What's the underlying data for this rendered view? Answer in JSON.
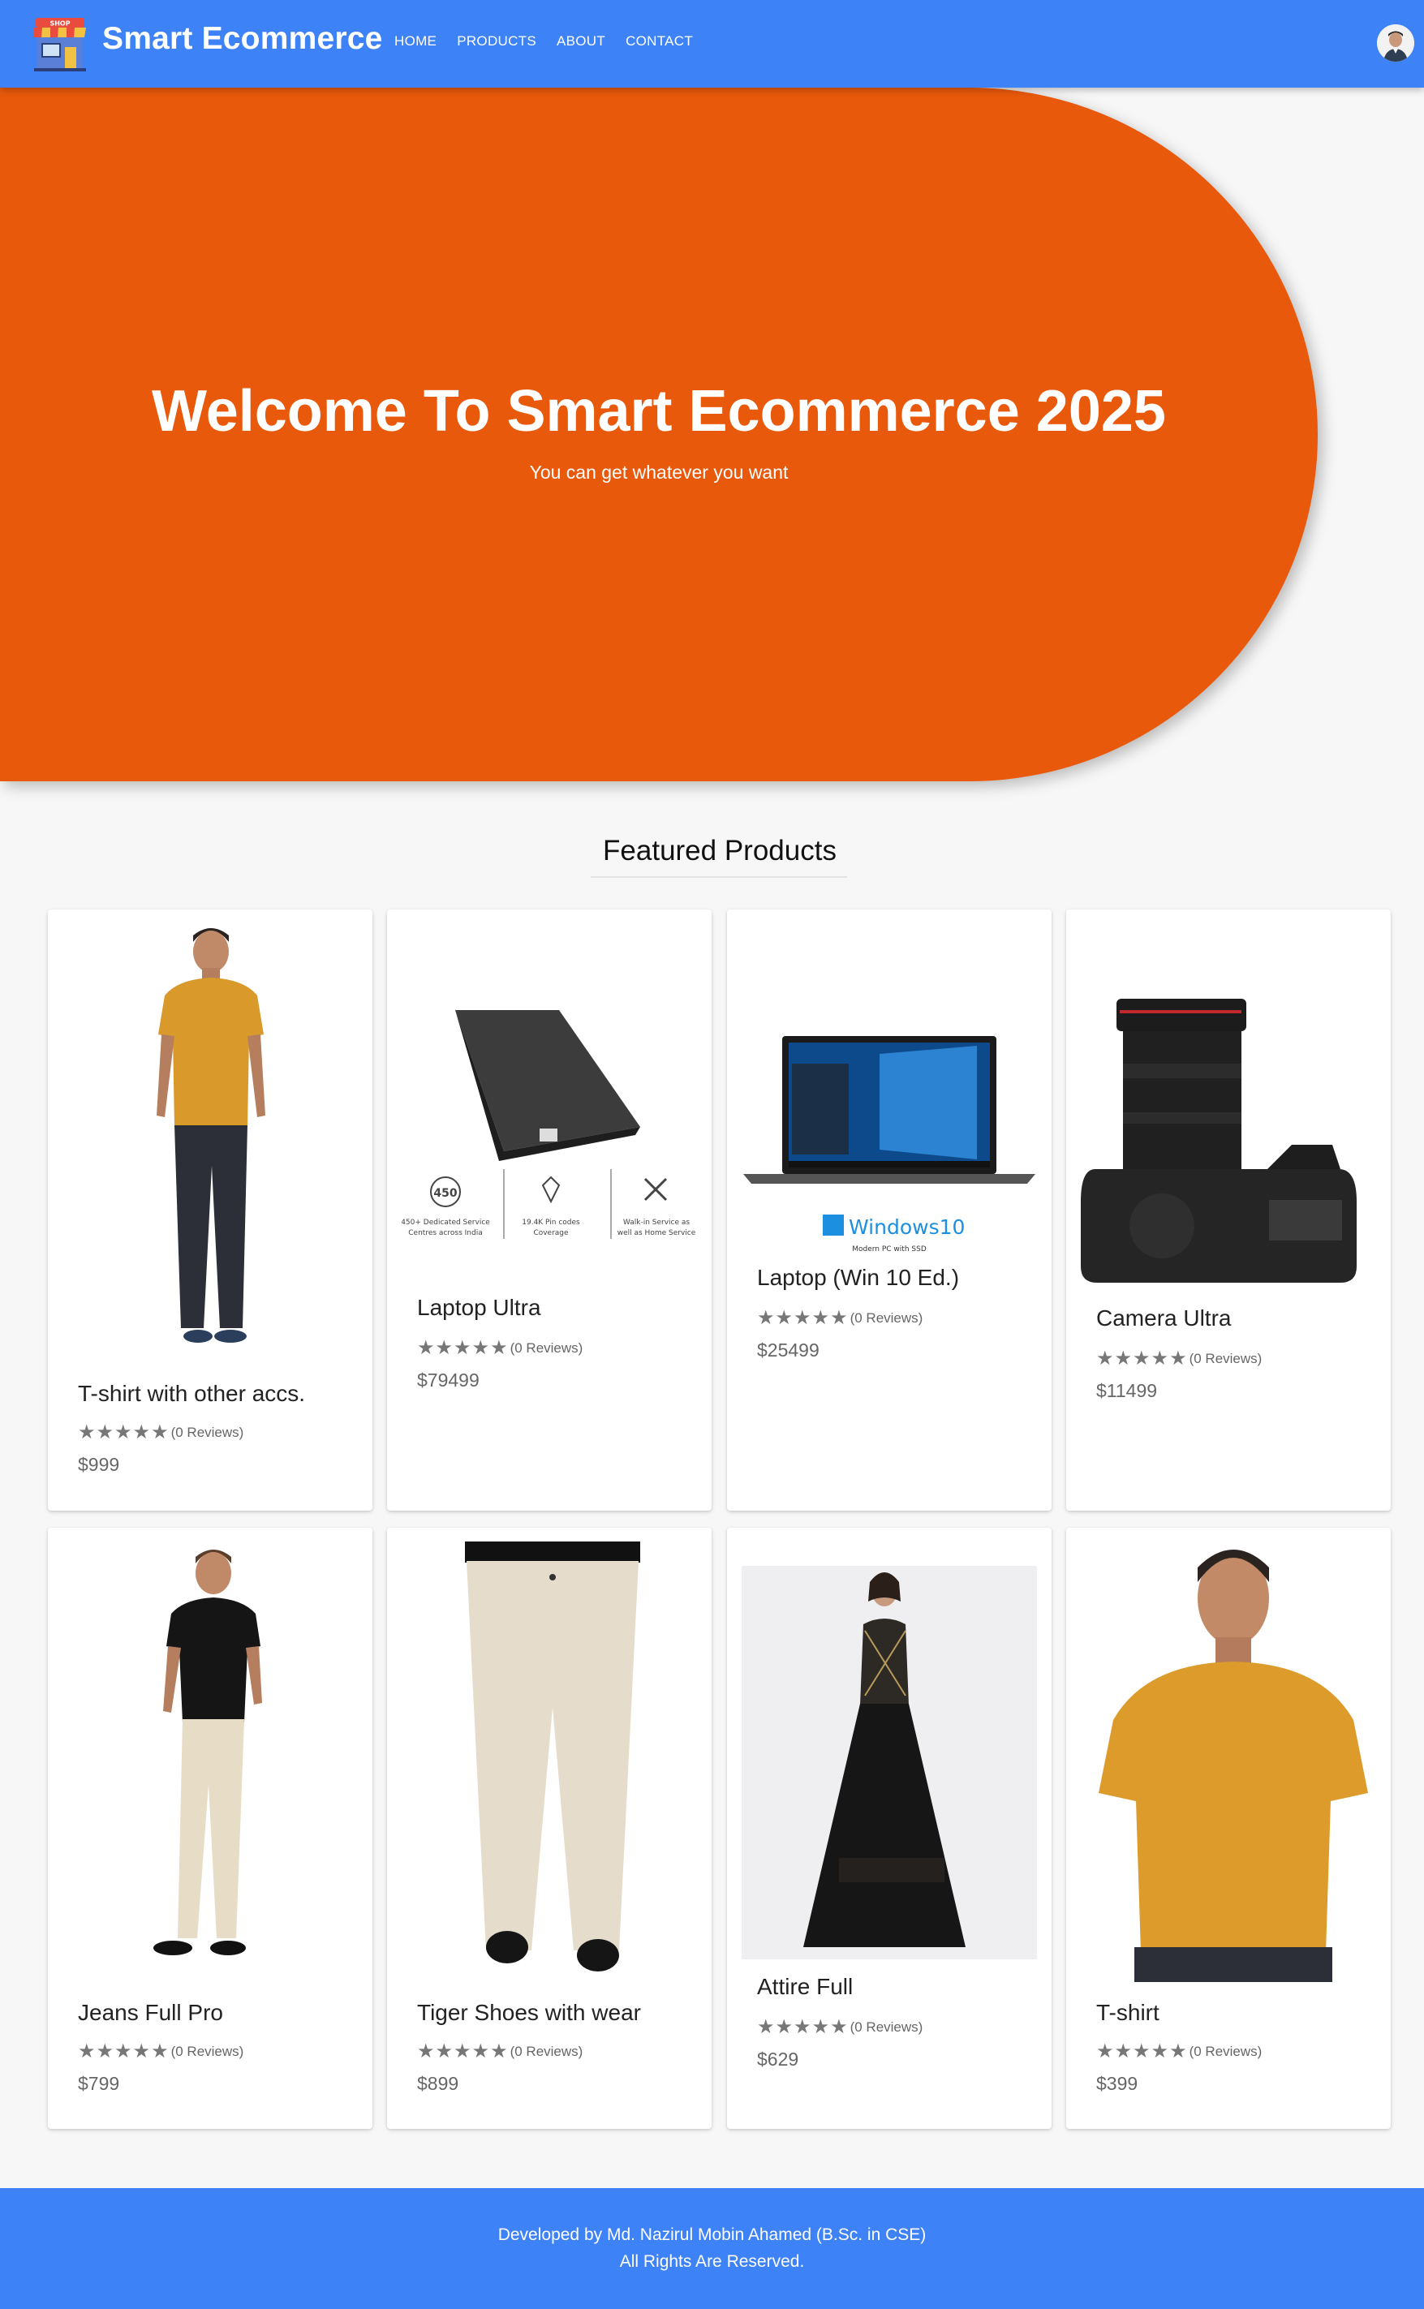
{
  "navbar": {
    "brand": "Smart Ecommerce",
    "logo_text": "SHOP",
    "links": [
      "HOME",
      "PRODUCTS",
      "ABOUT",
      "CONTACT"
    ],
    "bg_color": "#3d82f6"
  },
  "hero": {
    "title": "Welcome To Smart Ecommerce 2025",
    "subtitle": "You can get whatever you want",
    "bg_color": "#e8590c"
  },
  "featured": {
    "title": "Featured Products",
    "products": [
      {
        "name": "T-shirt with other accs.",
        "stars": "★★★★★",
        "reviews": "(0 Reviews)",
        "price": "$999"
      },
      {
        "name": "Laptop Ultra",
        "stars": "★★★★★",
        "reviews": "(0 Reviews)",
        "price": "$79499",
        "img_labels": [
          "450",
          "450+ Dedicated Service",
          "Centres across India",
          "19.4K Pin codes",
          "Coverage",
          "Walk-in Service as",
          "well as Home Service"
        ]
      },
      {
        "name": "Laptop (Win 10 Ed.)",
        "stars": "★★★★★",
        "reviews": "(0 Reviews)",
        "price": "$25499",
        "img_labels": [
          "Windows10",
          "Modern PC with SSD"
        ]
      },
      {
        "name": "Camera Ultra",
        "stars": "★★★★★",
        "reviews": "(0 Reviews)",
        "price": "$11499"
      },
      {
        "name": "Jeans Full Pro",
        "stars": "★★★★★",
        "reviews": "(0 Reviews)",
        "price": "$799"
      },
      {
        "name": "Tiger Shoes with wear",
        "stars": "★★★★★",
        "reviews": "(0 Reviews)",
        "price": "$899"
      },
      {
        "name": "Attire Full",
        "stars": "★★★★★",
        "reviews": "(0 Reviews)",
        "price": "$629"
      },
      {
        "name": "T-shirt",
        "stars": "★★★★★",
        "reviews": "(0 Reviews)",
        "price": "$399"
      }
    ]
  },
  "footer": {
    "line1": "Developed by Md. Nazirul Mobin Ahamed (B.Sc. in CSE)",
    "line2": "All Rights Are Reserved."
  }
}
